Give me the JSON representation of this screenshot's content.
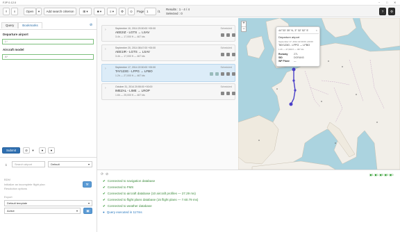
{
  "app": {
    "title": "FJP 0.12.0"
  },
  "toolbar": {
    "open_label": "Open",
    "add_criterion_label": "Add search criterion",
    "page_label": "Page",
    "page_value": "1",
    "page_total": "/1",
    "results_label": "Results : 1 - 4 / 4",
    "selected_label": "Selected : 0"
  },
  "left": {
    "tabs": [
      "Query",
      "Bookmarks"
    ],
    "departure_label": "Departure airport",
    "departure_value": "L*",
    "aircraft_label": "Aircraft model",
    "aircraft_value": "A*",
    "submit_label": "Submit",
    "search_airport_placeholder": "Search airport",
    "default_label": "Default",
    "bdm_label": "BDM",
    "bdm_note1": "Initialize an incomplete flight plan",
    "bdm_note2": "Resolution options",
    "export_label": "Export",
    "template_value": "Default template",
    "active_value": "Active"
  },
  "flights": [
    {
      "date": "September 10, 2014 20:30:00 +00:00",
      "route": "AEE2IZ - LGTS → LSAV",
      "meta": "3.4h — 17,000 ft — 467 kts",
      "status": "Scheduled"
    },
    {
      "date": "September 20, 2014 08:47:00 +00:00",
      "route": "AEE1IR - LGTS → LSAV",
      "meta": "3.4h — 17,000 ft — 467 kts",
      "status": "Scheduled"
    },
    {
      "date": "September 17, 2014 22:30:00 +00:00",
      "route": "TAY123G - LFPG → LFBO",
      "meta": "1.2h — 27,000 ft — 467 kts",
      "status": "Scheduled"
    },
    {
      "date": "October 31, 2014 20:55:00 +00:00",
      "route": "IMEZAL - LIME → LROP",
      "meta": "1.6h — 25,000 ft — 467 kts",
      "status": "Scheduled"
    }
  ],
  "map": {
    "coords": "44°33' 35\" N, 3° 32' 52\" E",
    "popup_title": "Departure airport",
    "popup_date": "September 17, 2014 22:30:00 +00:00",
    "popup_route": "TAY123G - LFPG → LFBO",
    "popup_meta": "1.2h — 27,000 ft — 467 kts",
    "runway_label": "Runway",
    "runway_value": "27L",
    "sid_label": "SID",
    "sid_value": "DORAN3",
    "wp_label": "WP Plane",
    "wp_value": "—",
    "zoom_in": "+",
    "zoom_out": "−"
  },
  "log": [
    {
      "text": "Connected to navigation database",
      "type": "ok"
    },
    {
      "text": "Connected to FMS",
      "type": "ok"
    },
    {
      "text": "Connected to aircraft database (10 aircraft profiles — 27.29 ms)",
      "type": "ok"
    },
    {
      "text": "Connected to flight plans database (15 flight plans — 7.60.79 ms)",
      "type": "ok"
    },
    {
      "text": "Connected to weather database",
      "type": "ok"
    },
    {
      "text": "Query executed in 117ms",
      "type": "info"
    }
  ],
  "colors": {
    "accent": "#2f6fb0",
    "success": "#3a9a3a",
    "route": "#4a3fc8",
    "sea": "#abd3df",
    "land": "#f2efe9"
  }
}
